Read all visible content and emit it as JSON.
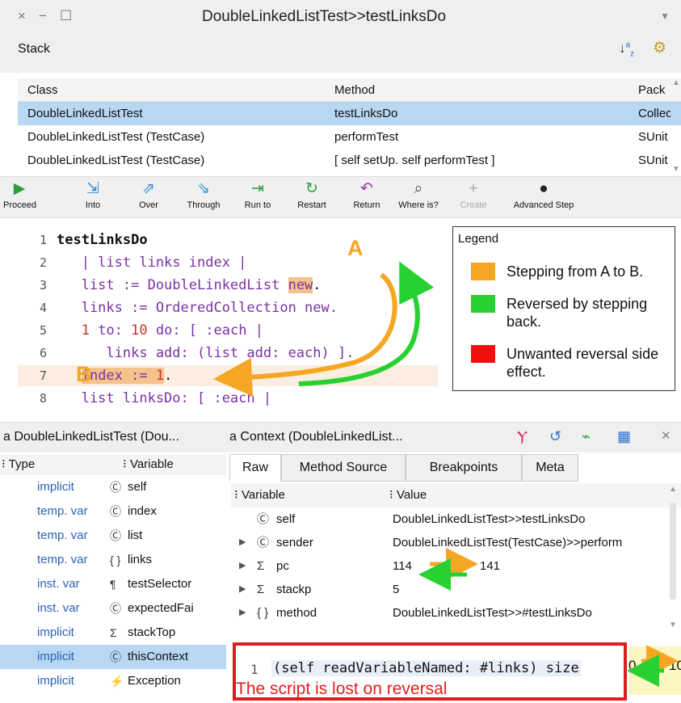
{
  "window": {
    "title": "DoubleLinkedListTest>>testLinksDo",
    "close_glyph": "×",
    "minimize_glyph": "−",
    "maximize_glyph": "☐",
    "menu_glyph": "▼"
  },
  "stack": {
    "label": "Stack",
    "sort_glyph": "↓a/z",
    "settings_glyph": "⚙",
    "columns": [
      "Class",
      "Method",
      "Pack"
    ],
    "rows": [
      {
        "class": "DoubleLinkedListTest",
        "method": "testLinksDo",
        "pack": "Collec",
        "selected": true
      },
      {
        "class": "DoubleLinkedListTest (TestCase)",
        "method": "performTest",
        "pack": "SUnit",
        "selected": false
      },
      {
        "class": "DoubleLinkedListTest (TestCase)",
        "method": "[ self setUp.  self performTest ]",
        "pack": "SUnit",
        "selected": false
      }
    ]
  },
  "toolbar": {
    "buttons": [
      {
        "label": "Proceed",
        "icon": "play-icon",
        "glyph": "▶",
        "color": "#2e9c3a"
      },
      {
        "label": "Into",
        "icon": "step-into-icon",
        "glyph": "⇲",
        "color": "#2f8fd0"
      },
      {
        "label": "Over",
        "icon": "step-over-icon",
        "glyph": "⇗",
        "color": "#2f8fd0"
      },
      {
        "label": "Through",
        "icon": "step-through-icon",
        "glyph": "⇘",
        "color": "#2f8fd0"
      },
      {
        "label": "Run to",
        "icon": "run-to-icon",
        "glyph": "⇥",
        "color": "#2e9c3a"
      },
      {
        "label": "Restart",
        "icon": "restart-icon",
        "glyph": "↻",
        "color": "#2e9c3a"
      },
      {
        "label": "Return",
        "icon": "return-icon",
        "glyph": "↶",
        "color": "#a23fa8"
      },
      {
        "label": "Where is?",
        "icon": "where-is-icon",
        "glyph": "⌕",
        "color": "#555555"
      },
      {
        "label": "Create",
        "icon": "create-icon",
        "glyph": "+",
        "color": "#aaaaaa"
      },
      {
        "label": "Advanced Step",
        "icon": "bomb-icon",
        "glyph": "●",
        "color": "#222222"
      }
    ]
  },
  "code": {
    "lines": [
      {
        "n": "1",
        "text": "testLinksDo"
      },
      {
        "n": "2",
        "text": "   | list links index |"
      },
      {
        "n": "3",
        "pre": "   list := DoubleLinkedList ",
        "hl": "new",
        "post": "."
      },
      {
        "n": "4",
        "pre": "   links := OrderedCollection new."
      },
      {
        "n": "5",
        "num": "1",
        "mid": " to: ",
        "num2": "10",
        "post": " do: [ :each |"
      },
      {
        "n": "6",
        "text": "      links add: (list add: each) ]."
      },
      {
        "n": "7",
        "hl": "index := ",
        "num": "1",
        "post": "."
      },
      {
        "n": "8",
        "text": "   list linksDo: [ :each |"
      }
    ],
    "marker_a": "A",
    "marker_b": "B"
  },
  "legend": {
    "title": "Legend",
    "entries": [
      {
        "color": "#f5a623",
        "label": "Stepping from A to B."
      },
      {
        "color": "#27d12f",
        "label": "Reversed by stepping back."
      },
      {
        "color": "#f01010",
        "label": "Unwanted reversal side effect."
      }
    ]
  },
  "inspector": {
    "left_title": "a DoubleLinkedListTest (Dou...",
    "right_title": "a Context (DoubleLinkedList...",
    "var_columns": [
      "Type",
      "Variable"
    ],
    "vars": [
      {
        "type": "implicit",
        "icon": "Ⓒ",
        "name": "self"
      },
      {
        "type": "temp. var",
        "icon": "Ⓒ",
        "name": "index"
      },
      {
        "type": "temp. var",
        "icon": "Ⓒ",
        "name": "list"
      },
      {
        "type": "temp. var",
        "icon": "{ }",
        "name": "links"
      },
      {
        "type": "inst. var",
        "icon": "¶",
        "name": "testSelector"
      },
      {
        "type": "inst. var",
        "icon": "Ⓒ",
        "name": "expectedFai"
      },
      {
        "type": "implicit",
        "icon": "Σ",
        "name": "stackTop"
      },
      {
        "type": "implicit",
        "icon": "Ⓒ",
        "name": "thisContext",
        "selected": true
      },
      {
        "type": "implicit",
        "icon": "⚡",
        "name": "Exception"
      }
    ],
    "tabs": [
      "Raw",
      "Method Source",
      "Breakpoints",
      "Meta"
    ],
    "raw_columns": [
      "Variable",
      "Value"
    ],
    "raw_rows": [
      {
        "expand": "",
        "icon": "Ⓒ",
        "name": "self",
        "value": "DoubleLinkedListTest>>testLinksDo"
      },
      {
        "expand": "▶",
        "icon": "Ⓒ",
        "name": "sender",
        "value": "DoubleLinkedListTest(TestCase)>>perform"
      },
      {
        "expand": "▶",
        "icon": "Σ",
        "name": "pc",
        "value": "114",
        "value2": "141"
      },
      {
        "expand": "▶",
        "icon": "Σ",
        "name": "stackp",
        "value": "5"
      },
      {
        "expand": "▶",
        "icon": "{ }",
        "name": "method",
        "value": "DoubleLinkedListTest>>#testLinksDo"
      }
    ],
    "script": {
      "line_no": "1",
      "code": "(self readVariableNamed: #links) size",
      "result_before": "0",
      "result_after": "10",
      "warning": "The script is lost on reversal"
    }
  }
}
